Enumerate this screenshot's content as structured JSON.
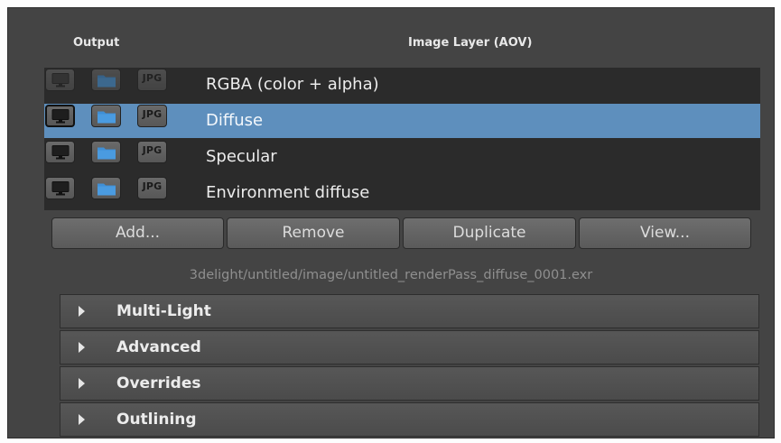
{
  "header": {
    "output_label": "Output",
    "layer_label": "Image Layer (AOV)"
  },
  "layers": [
    {
      "name": "RGBA (color + alpha)",
      "selected": false,
      "display_enabled": false,
      "jpg_label": "JPG"
    },
    {
      "name": "Diffuse",
      "selected": true,
      "display_enabled": true,
      "jpg_label": "JPG"
    },
    {
      "name": "Specular",
      "selected": false,
      "display_enabled": true,
      "jpg_label": "JPG"
    },
    {
      "name": "Environment diffuse",
      "selected": false,
      "display_enabled": true,
      "jpg_label": "JPG"
    }
  ],
  "buttons": {
    "add": "Add...",
    "remove": "Remove",
    "duplicate": "Duplicate",
    "view": "View..."
  },
  "output_path": "3delight/untitled/image/untitled_renderPass_diffuse_0001.exr",
  "sections": [
    {
      "title": "Multi-Light",
      "expanded": false
    },
    {
      "title": "Advanced",
      "expanded": false
    },
    {
      "title": "Overrides",
      "expanded": false
    },
    {
      "title": "Outlining",
      "expanded": false
    }
  ],
  "colors": {
    "panel_bg": "#444444",
    "list_bg": "#2b2b2b",
    "selection": "#5e8fbd",
    "folder_icon": "#3f8fd6",
    "path_text": "#8f8f8f"
  }
}
